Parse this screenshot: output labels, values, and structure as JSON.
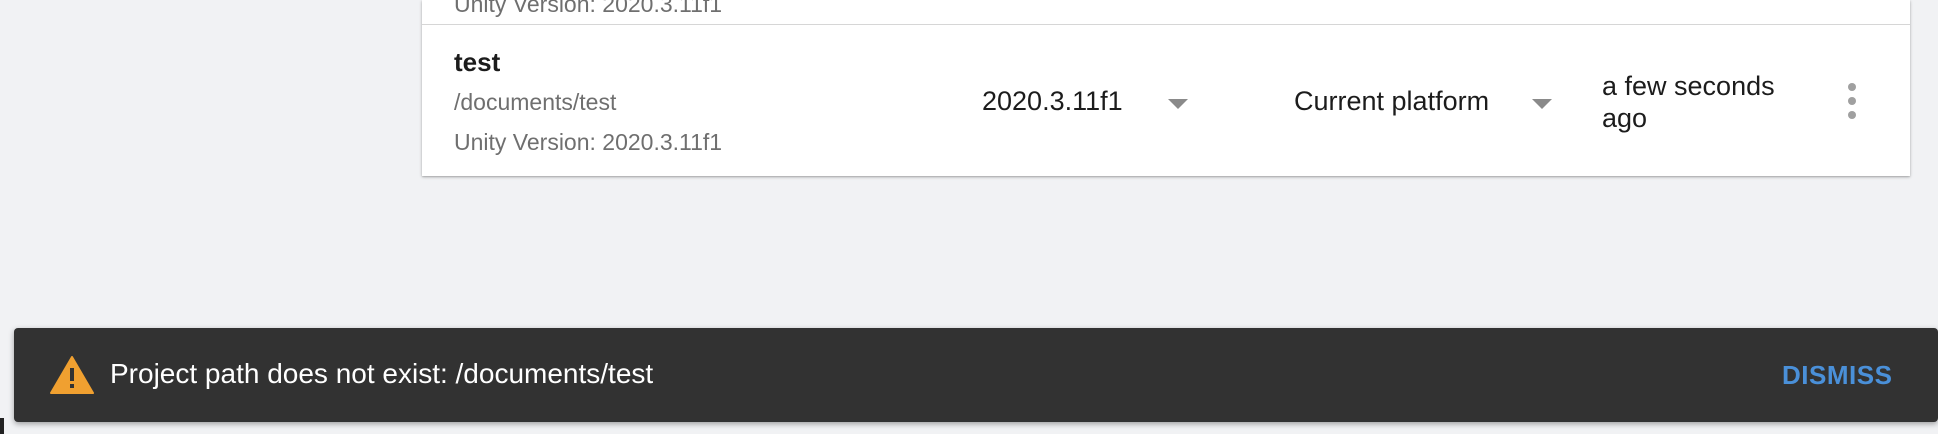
{
  "project_row": {
    "name": "test",
    "path": "/documents/test",
    "unity_version_label": "Unity Version: 2020.3.11f1",
    "version_select": {
      "selected": "2020.3.11f1",
      "icon": "chevron-down-icon"
    },
    "platform_select": {
      "selected": "Current platform",
      "icon": "chevron-down-icon"
    },
    "last_modified": "a few seconds ago",
    "more_icon": "more-vertical-icon"
  },
  "previous_row": {
    "clipped_text": "Unity Version: 2020.3.11f1"
  },
  "snackbar": {
    "icon": "warning-icon",
    "message": "Project path does not exist: /documents/test",
    "action_label": "DISMISS",
    "colors": {
      "background": "#323232",
      "text": "#ffffff",
      "action": "#4a90d9",
      "icon": "#f0a030"
    }
  }
}
